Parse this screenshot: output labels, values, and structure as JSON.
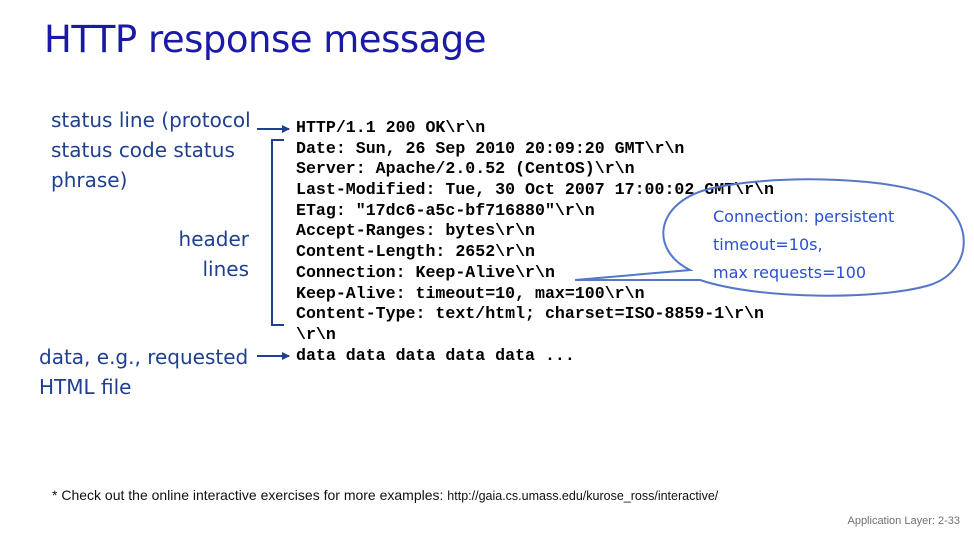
{
  "title": "HTTP response message",
  "labels": {
    "status_line": [
      "status line (protocol",
      "status code status",
      "phrase)"
    ],
    "header_lines": [
      "header",
      "lines"
    ],
    "data": [
      "data, e.g.,  requested",
      "HTML file"
    ]
  },
  "response_lines": [
    "HTTP/1.1 200 OK\\r\\n",
    "Date: Sun, 26 Sep 2010 20:09:20 GMT\\r\\n",
    "Server: Apache/2.0.52 (CentOS)\\r\\n",
    "Last-Modified: Tue, 30 Oct 2007 17:00:02 GMT\\r\\n",
    "ETag: \"17dc6-a5c-bf716880\"\\r\\n",
    "Accept-Ranges: bytes\\r\\n",
    "Content-Length: 2652\\r\\n",
    "Connection: Keep-Alive\\r\\n",
    "Keep-Alive: timeout=10, max=100\\r\\n",
    "Content-Type: text/html; charset=ISO-8859-1\\r\\n",
    "\\r\\n",
    "data data data data data ..."
  ],
  "bubble": [
    "Connection: persistent",
    "timeout=10s,",
    "max requests=100"
  ],
  "footnote": {
    "text": "* Check out the online interactive exercises for more examples: ",
    "url": "http://gaia.cs.umass.edu/kurose_ross/interactive/"
  },
  "page_number": "Application Layer: 2-33",
  "colors": {
    "title": "#1a1aa6",
    "label": "#1f3f8f",
    "bubble_stroke": "#5577c8",
    "bubble_text": "#2a4fd0"
  }
}
